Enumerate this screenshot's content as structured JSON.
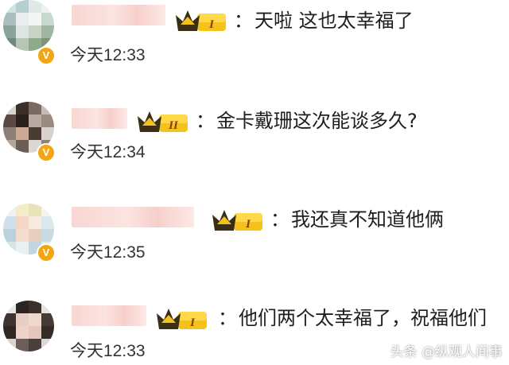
{
  "comments": [
    {
      "avatar_style": "cat-photo",
      "crown_level": "I",
      "separator": "：",
      "text": "天啦 这也太幸福了",
      "time": "今天12:33"
    },
    {
      "avatar_style": "dark-photo",
      "crown_level": "II",
      "separator": "：",
      "text": "金卡戴珊这次能谈多久?",
      "time": "今天12:34"
    },
    {
      "avatar_style": "light-photo",
      "crown_level": "I",
      "separator": "：",
      "text": "我还真不知道他俩",
      "time": "今天12:35"
    },
    {
      "avatar_style": "woman-photo",
      "crown_level": "I",
      "separator": "：",
      "text": "他们两个太幸福了，祝福他们",
      "time": "今天12:33"
    }
  ],
  "verified_badge_letter": "V",
  "watermark": "头条 @纵观人间事",
  "colors": {
    "badge": "#f2a614",
    "crown_dark": "#3a2e14",
    "crown_gold": "#f5c21b",
    "name_blur": "#f9d6d2"
  }
}
